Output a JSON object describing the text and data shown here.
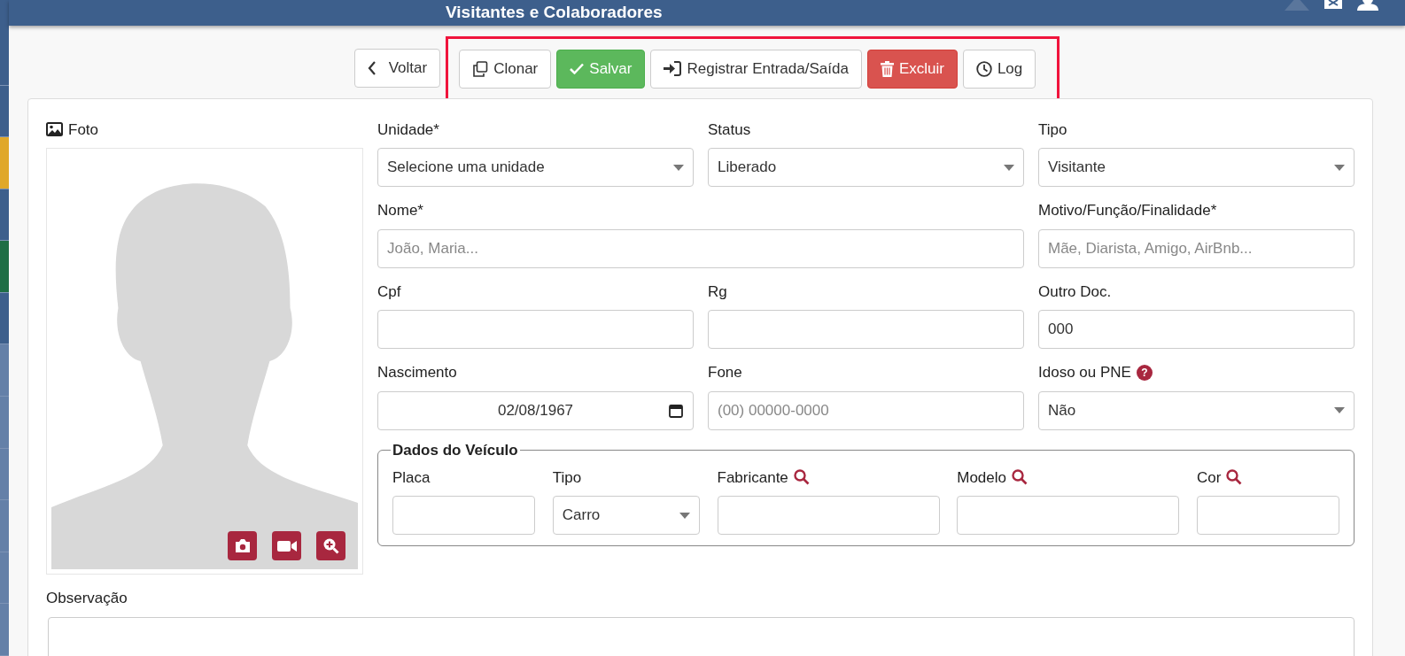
{
  "sidebar": {
    "items": [
      {
        "color": "#3d5f8c"
      },
      {
        "color": "#3d5f8c"
      },
      {
        "color": "#e0a82a"
      },
      {
        "color": "#3d5f8c"
      },
      {
        "color": "#1e6e45"
      },
      {
        "color": "#3d5f8c"
      },
      {
        "color": "#6480a8"
      },
      {
        "color": "#6480a8"
      },
      {
        "color": "#6480a8"
      },
      {
        "color": "#6480a8"
      },
      {
        "color": "#6480a8"
      },
      {
        "color": "#6480a8"
      }
    ]
  },
  "header": {
    "title": "Visitantes e Colaboradores"
  },
  "toolbar": {
    "buttons": [
      {
        "label": "Voltar",
        "kind": "back",
        "highlighted": false
      },
      {
        "label": "Clonar",
        "kind": "clone",
        "highlighted": true
      },
      {
        "label": "Salvar",
        "kind": "save",
        "highlighted": true
      },
      {
        "label": "Registrar Entrada/Saída",
        "kind": "register",
        "highlighted": true
      },
      {
        "label": "Excluir",
        "kind": "delete",
        "highlighted": true
      },
      {
        "label": "Log",
        "kind": "log",
        "highlighted": true
      }
    ]
  },
  "photo": {
    "label": "Foto"
  },
  "form": {
    "fields": [
      {
        "label": "Unidade*",
        "kind": "select",
        "value": "Selecione uma unidade"
      },
      {
        "label": "Status",
        "kind": "select",
        "value": "Liberado"
      },
      {
        "label": "Tipo",
        "kind": "select",
        "value": "Visitante"
      },
      {
        "label": "Nome*",
        "kind": "wide_input",
        "placeholder": "João, Maria..."
      },
      {
        "label": "Motivo/Função/Finalidade*",
        "kind": "input",
        "placeholder": "Mãe, Diarista, Amigo, AirBnb..."
      },
      {
        "label": "Cpf",
        "kind": "input"
      },
      {
        "label": "Rg",
        "kind": "input"
      },
      {
        "label": "Outro Doc.",
        "kind": "input",
        "value": "000"
      },
      {
        "label": "Nascimento",
        "kind": "date",
        "value": "02/08/1967"
      },
      {
        "label": "Fone",
        "kind": "input",
        "placeholder": "(00) 00000-0000"
      },
      {
        "label": "Idoso ou PNE",
        "kind": "select",
        "value": "Não",
        "help": "?"
      }
    ]
  },
  "vehicle": {
    "legend": "Dados do Veículo",
    "fields": [
      {
        "label": "Placa",
        "kind": "input",
        "search": false
      },
      {
        "label": "Tipo",
        "kind": "select",
        "value": "Carro",
        "search": false
      },
      {
        "label": "Fabricante",
        "kind": "input",
        "search": true
      },
      {
        "label": "Modelo",
        "kind": "input",
        "search": true
      },
      {
        "label": "Cor",
        "kind": "input",
        "search": true
      }
    ]
  },
  "notes": {
    "label": "Observação"
  }
}
